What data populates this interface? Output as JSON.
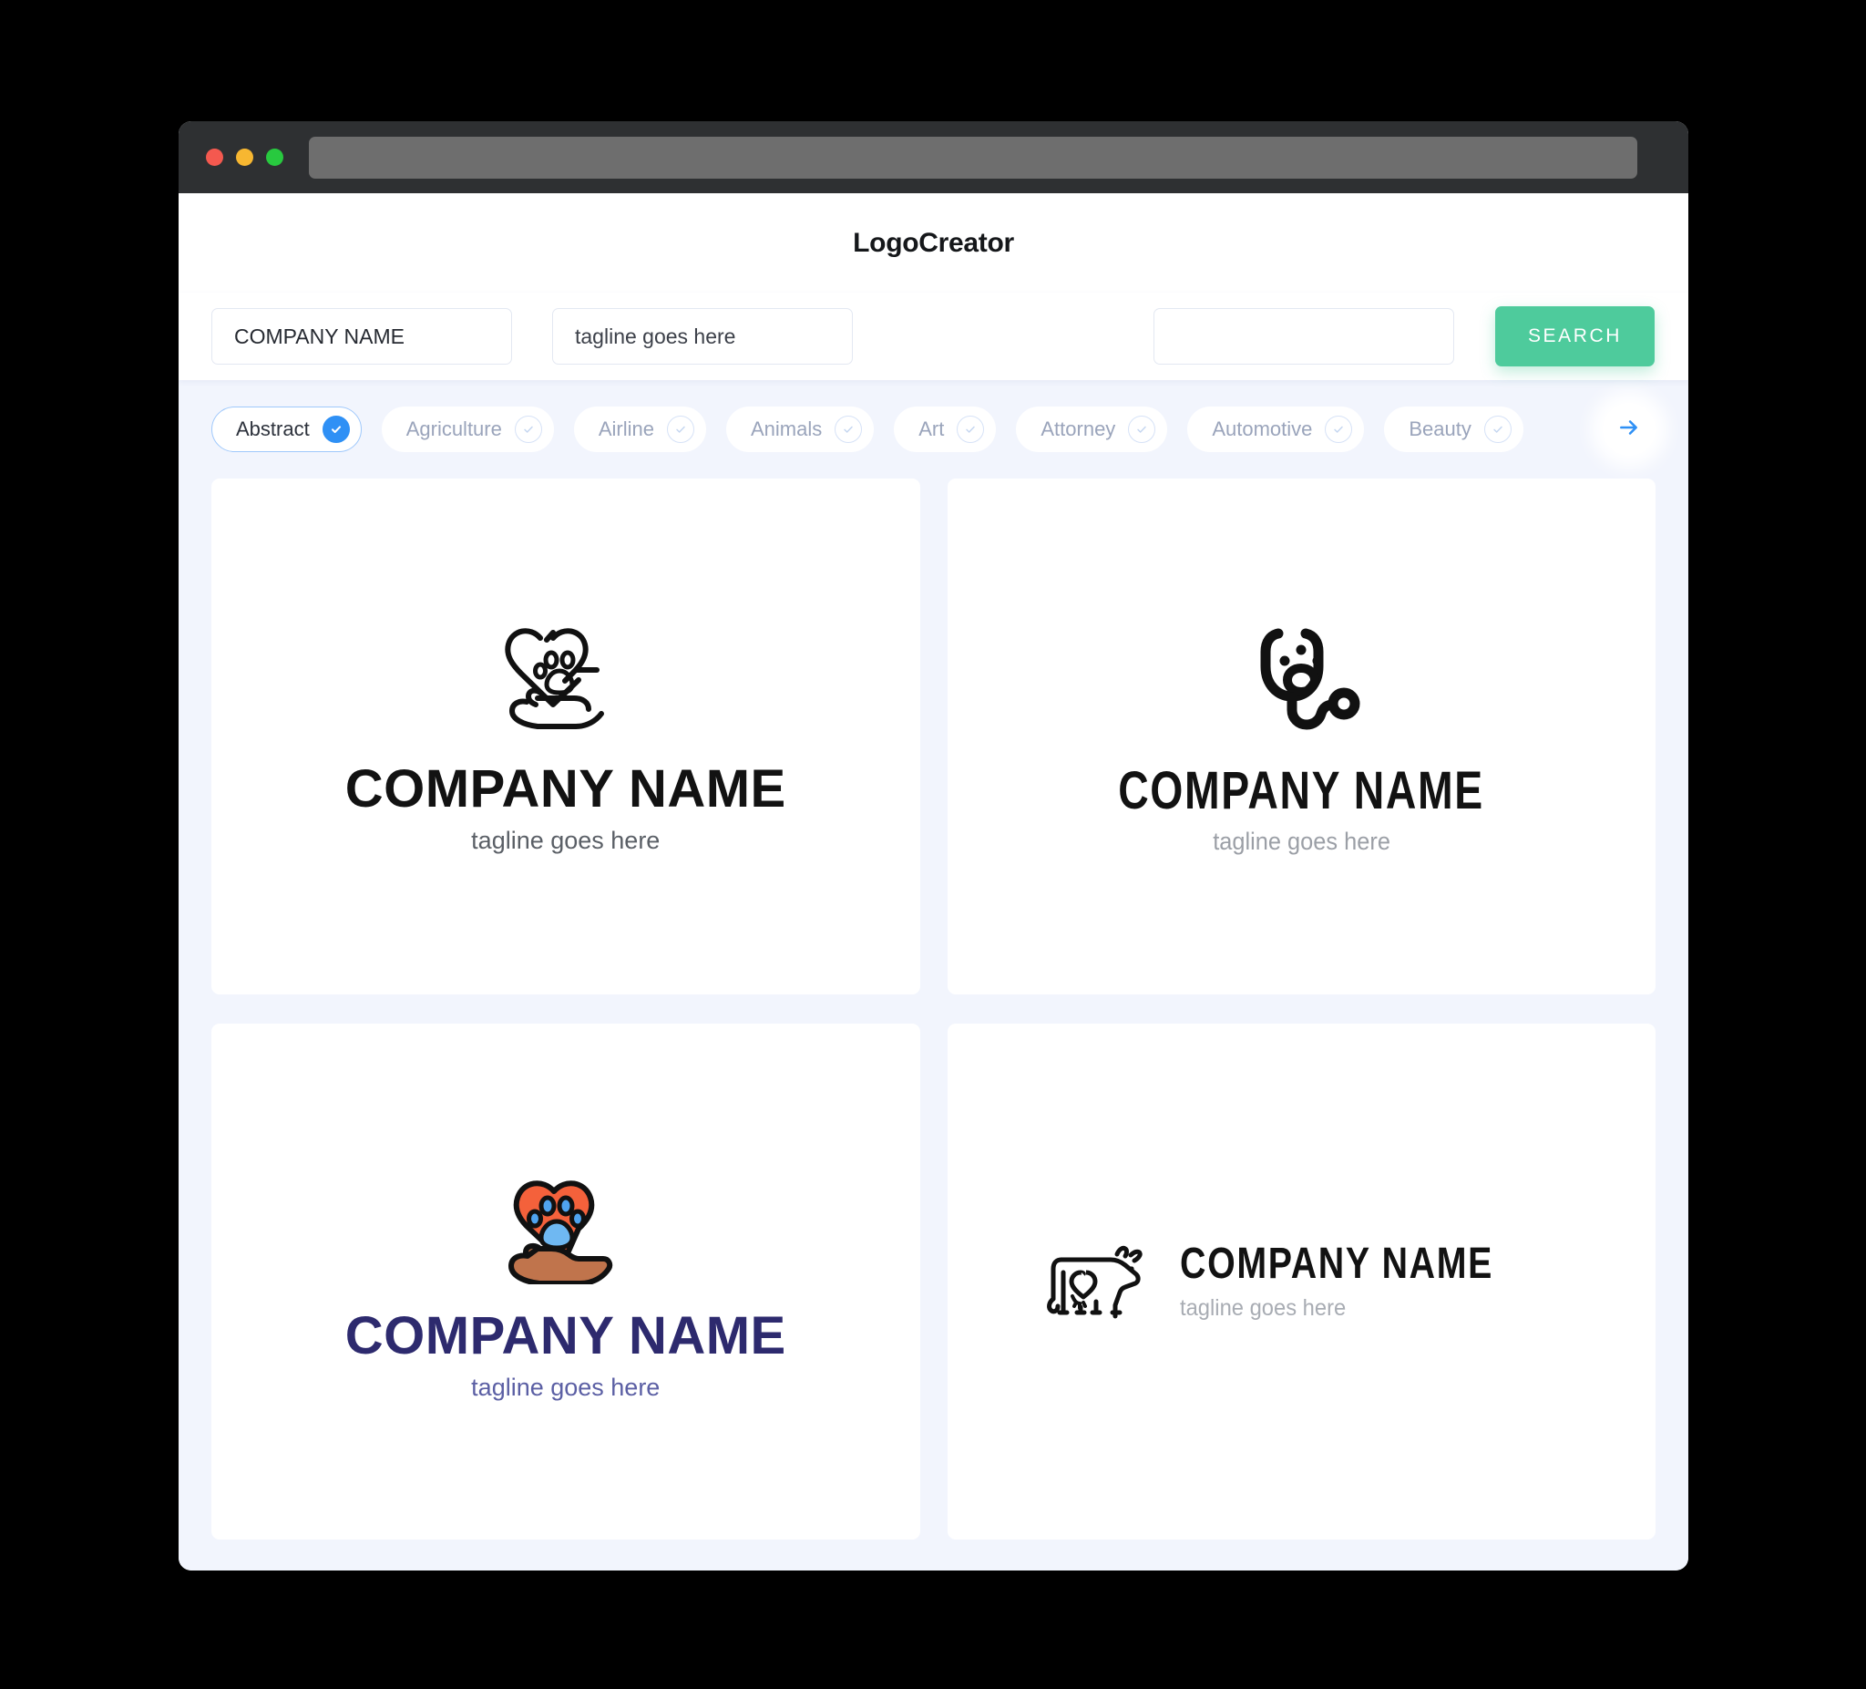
{
  "browser": {
    "traffic_lights": [
      {
        "name": "close",
        "color": "#f4594f"
      },
      {
        "name": "minimize",
        "color": "#f7b731"
      },
      {
        "name": "maximize",
        "color": "#28c93f"
      }
    ],
    "url_value": "",
    "url_placeholder": ""
  },
  "header": {
    "title": "LogoCreator"
  },
  "search": {
    "company_value": "COMPANY NAME",
    "company_placeholder": "COMPANY NAME",
    "tagline_value": "tagline goes here",
    "tagline_placeholder": "tagline goes here",
    "extra_value": "",
    "extra_placeholder": "",
    "button_label": "SEARCH",
    "button_color": "#4ecb9c"
  },
  "categories": {
    "accent_color": "#2f90f5",
    "items": [
      {
        "label": "Abstract",
        "selected": true
      },
      {
        "label": "Agriculture",
        "selected": false
      },
      {
        "label": "Airline",
        "selected": false
      },
      {
        "label": "Animals",
        "selected": false
      },
      {
        "label": "Art",
        "selected": false
      },
      {
        "label": "Attorney",
        "selected": false
      },
      {
        "label": "Automotive",
        "selected": false
      },
      {
        "label": "Beauty",
        "selected": false
      }
    ],
    "next_label": "next-categories"
  },
  "logos": [
    {
      "mark": "heart-paw-in-hand-outline-icon",
      "name": "COMPANY NAME",
      "tagline": "tagline goes here",
      "name_color": "#121212",
      "tagline_color": "#5a5f66",
      "layout": "stacked"
    },
    {
      "mark": "stethoscope-dog-face-icon",
      "name": "COMPANY NAME",
      "tagline": "tagline goes here",
      "name_color": "#121212",
      "tagline_color": "#9b9fa6",
      "layout": "stacked"
    },
    {
      "mark": "heart-paw-in-hand-color-icon",
      "name": "COMPANY NAME",
      "tagline": "tagline goes here",
      "name_color": "#2d2a6e",
      "tagline_color": "#5b5fa4",
      "layout": "stacked"
    },
    {
      "mark": "cow-with-heart-icon",
      "name": "COMPANY NAME",
      "tagline": "tagline goes here",
      "name_color": "#121212",
      "tagline_color": "#a8acb3",
      "layout": "inline"
    }
  ]
}
